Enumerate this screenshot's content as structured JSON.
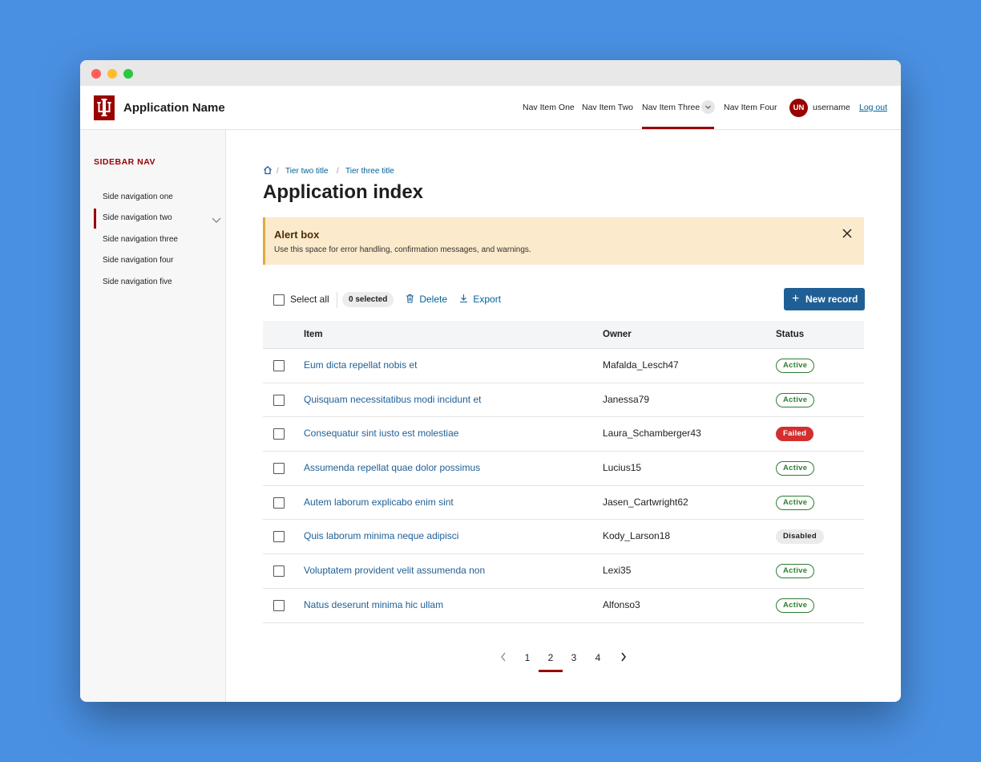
{
  "app": {
    "name": "Application Name"
  },
  "nav": {
    "items": [
      "Nav Item One",
      "Nav Item Two",
      "Nav Item Three",
      "Nav Item Four"
    ],
    "active_index": 2,
    "user_initials": "UN",
    "username": "username",
    "logout": "Log out"
  },
  "sidebar": {
    "title": "SIDEBAR NAV",
    "items": [
      "Side navigation one",
      "Side navigation two",
      "Side navigation three",
      "Side navigation four",
      "Side navigation five"
    ],
    "active_index": 1
  },
  "breadcrumb": {
    "items": [
      "Tier two title",
      "Tier three title"
    ],
    "separator": "/"
  },
  "page": {
    "title": "Application index"
  },
  "alert": {
    "title": "Alert box",
    "message": "Use this space for error handling, confirmation messages, and warnings."
  },
  "toolbar": {
    "select_all": "Select all",
    "selected_count": "0 selected",
    "delete": "Delete",
    "export": "Export",
    "new_record": "New record"
  },
  "table": {
    "columns": [
      "Item",
      "Owner",
      "Status"
    ],
    "rows": [
      {
        "item": "Eum dicta repellat nobis et",
        "owner": "Mafalda_Lesch47",
        "status": "Active",
        "kind": "active"
      },
      {
        "item": "Quisquam necessitatibus modi incidunt et",
        "owner": "Janessa79",
        "status": "Active",
        "kind": "active"
      },
      {
        "item": "Consequatur sint iusto est molestiae",
        "owner": "Laura_Schamberger43",
        "status": "Failed",
        "kind": "failed"
      },
      {
        "item": "Assumenda repellat quae dolor possimus",
        "owner": "Lucius15",
        "status": "Active",
        "kind": "active"
      },
      {
        "item": "Autem laborum explicabo enim sint",
        "owner": "Jasen_Cartwright62",
        "status": "Active",
        "kind": "active"
      },
      {
        "item": "Quis laborum minima neque adipisci",
        "owner": "Kody_Larson18",
        "status": "Disabled",
        "kind": "disabled"
      },
      {
        "item": "Voluptatem provident velit assumenda non",
        "owner": "Lexi35",
        "status": "Active",
        "kind": "active"
      },
      {
        "item": "Natus deserunt minima hic ullam",
        "owner": "Alfonso3",
        "status": "Active",
        "kind": "active"
      }
    ]
  },
  "pagination": {
    "pages": [
      "1",
      "2",
      "3",
      "4"
    ],
    "current": "2"
  },
  "colors": {
    "brand": "#990000",
    "link": "#006298",
    "button": "#1f5f95",
    "alert_bg": "#fbeacc",
    "page_bg": "#4a90e2"
  }
}
